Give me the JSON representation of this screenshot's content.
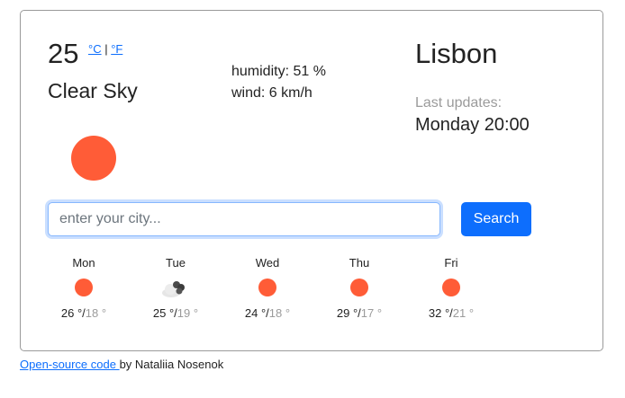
{
  "weather": {
    "temperature": "25",
    "unit_celsius": "°C",
    "unit_separator": " | ",
    "unit_fahrenheit": "°F",
    "description": "Clear Sky",
    "icon": "sun-icon",
    "humidity": "humidity: 51 %",
    "wind": "wind: 6 km/h",
    "city": "Lisbon",
    "updated_label": "Last updates:",
    "updated_value": "Monday 20:00"
  },
  "search": {
    "placeholder": "enter your city...",
    "value": "",
    "button_label": "Search"
  },
  "forecast": [
    {
      "day": "Mon",
      "icon": "sun-icon",
      "max": "26 °/",
      "min": "18 °"
    },
    {
      "day": "Tue",
      "icon": "cloud-icon",
      "max": "25 °/",
      "min": "19 °"
    },
    {
      "day": "Wed",
      "icon": "sun-icon",
      "max": "24 °/",
      "min": "18 °"
    },
    {
      "day": "Thu",
      "icon": "sun-icon",
      "max": "29 °/",
      "min": "17 °"
    },
    {
      "day": "Fri",
      "icon": "sun-icon",
      "max": "32 °/",
      "min": "21 °"
    }
  ],
  "footer": {
    "link_text": "Open-source code ",
    "suffix": "by Nataliia Nosenok"
  },
  "colors": {
    "accent": "#0d6efd",
    "sun": "#ff5c37",
    "muted": "#9b9b9b"
  }
}
